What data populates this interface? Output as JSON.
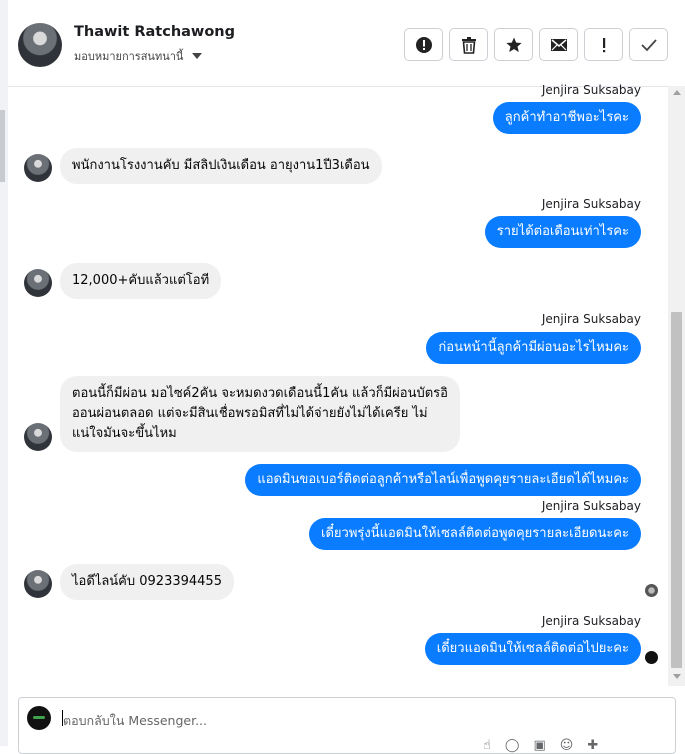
{
  "header": {
    "name": "Thawit Ratchawong",
    "assign_label": "มอบหมายการสนทนานี้"
  },
  "toolbar": {
    "buttons": [
      "alert-circle-icon",
      "trash-icon",
      "star-icon",
      "mail-icon",
      "exclamation-icon",
      "check-icon"
    ]
  },
  "messages": {
    "m1": {
      "sender": "Jenjira Suksabay",
      "text": "ลูกค้าทำอาชีพอะไรคะ"
    },
    "m2": {
      "text": "พนักงานโรงงานคับ มีสลิปเงินเดือน อายุงาน1ปี3เดือน"
    },
    "m3": {
      "sender": "Jenjira Suksabay",
      "text": "รายได้ต่อเดือนเท่าไรคะ"
    },
    "m4": {
      "text": "12,000+คับแล้วแต่โอที"
    },
    "m5": {
      "sender": "Jenjira Suksabay",
      "text": "ก่อนหน้านี้ลูกค้ามีผ่อนอะไรไหมคะ"
    },
    "m6": {
      "line1": "ตอนนี้ก็มีผ่อน มอไซค์2คัน จะหมดงวดเดือนนี้1คัน แล้วก็มีผ่อนบัตรอิ",
      "line2": "ออนผ่อนตลอด  แต่จะมีสินเชื่อพรอมิสที่ไม่ได้จ่ายยังไม่ได้เครีย ไม่",
      "line3": "แน่ใจมันจะขึ้นไหม"
    },
    "m7": {
      "text": "แอดมินขอเบอร์ติดต่อลูกค้าหรือไลน์เพื่อพูดคุยรายละเอียดได้ไหมคะ"
    },
    "m8": {
      "sender": "Jenjira Suksabay",
      "text": "เดี๋ยวพรุ่งนี้แอดมินให้เซลล์ติดต่อพูดคุยรายละเอียดนะคะ"
    },
    "m9": {
      "text": "ไอดีไลน์คับ 0923394455"
    },
    "m10": {
      "sender": "Jenjira Suksabay",
      "text": "เดี๋ยวแอดมินให้เซลล์ติดต่อไปยะคะ"
    }
  },
  "composer": {
    "placeholder": "ตอบกลับใน Messenger..."
  },
  "colors": {
    "outgoing_bubble": "#0a7cff",
    "incoming_bubble": "#f0f0f0"
  }
}
